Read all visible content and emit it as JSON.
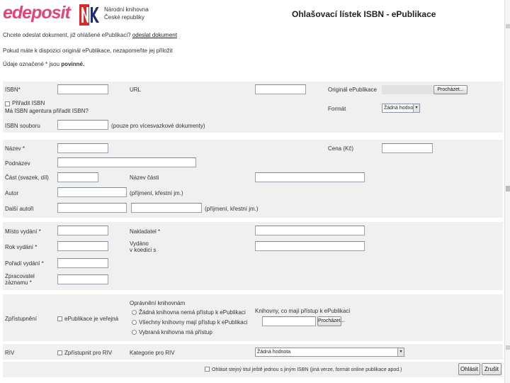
{
  "header": {
    "logo_text": "edeposit",
    "nk_logo_letters": "NK",
    "nk_name_line1": "Národní knihovna",
    "nk_name_line2": "České republiky",
    "form_title": "Ohlašovací lístek ISBN - ePublikace"
  },
  "intro": {
    "line1_text": "Chcete odeslat dokument, již ohlášené ePublikaci?",
    "line1_link": "odeslat dokument",
    "line2_text": "Pokud máte k dispozici originál ePublikace, nezapomeňte jej přiložit",
    "line3_text": "Údaje označené * jsou",
    "line3_bold": "povinné."
  },
  "fields": {
    "isbn_label": "ISBN*",
    "url_label": "URL",
    "original_label": "Originál ePublikace",
    "browse_label": "Procházet...",
    "assign_isbn_line1": "Přiřadit ISBN",
    "assign_isbn_line2": "Má ISBN agentura přiřadit ISBN?",
    "format_label": "Formát",
    "format_value": "Žádná hodnota",
    "isbn_set_label": "ISBN souboru",
    "isbn_set_note": "(pouze pro vícesvazkové dokumenty)",
    "title_label": "Název *",
    "price_label": "Cena (Kč)",
    "subtitle_label": "Podnázev",
    "part_label": "Část (svazek, díl)",
    "part_name_label": "Název části",
    "author_label": "Autor",
    "author_note": "(příjmení, křestní jm.)",
    "other_authors_label": "Další autoři",
    "other_authors_note": "(příjmení, křestní jm.)",
    "place_label": "Místo vydání *",
    "publisher_label": "Nakladatel *",
    "year_label": "Rok vydání *",
    "coedition_line1": "Vydáno",
    "coedition_line2": "v koedici s",
    "edition_order_label": "Pořadí vydání *",
    "processor_line1": "Zpracovatel",
    "processor_line2": "záznamu *",
    "access_label": "Zpřístupnění",
    "public_epub_label": "ePublikace je veřejná",
    "library_access_title": "Oprávnění knihovnám",
    "radio1": "Žádná knihovna nemá přístup k ePublikaci",
    "radio2": "Všechny knihovny mají přístup k ePublikaci",
    "radio3": "Vybraná knihovna má přístup",
    "library_access_note": "Knihovny, co mají přístup k ePublikaci",
    "riv_label": "RIV",
    "riv_checkbox": "Zpřístupnit pro RIV",
    "riv_category_label": "Kategorie pro RIV",
    "riv_category_value": "Žádná hodnota"
  },
  "footer": {
    "ignore_text": "Ohlásit stejný titul ještě jednou s jiným ISBN (jiná verze, formát online publikace apod.)",
    "submit_label": "Ohlásit",
    "cancel_label": "Zrušit"
  }
}
